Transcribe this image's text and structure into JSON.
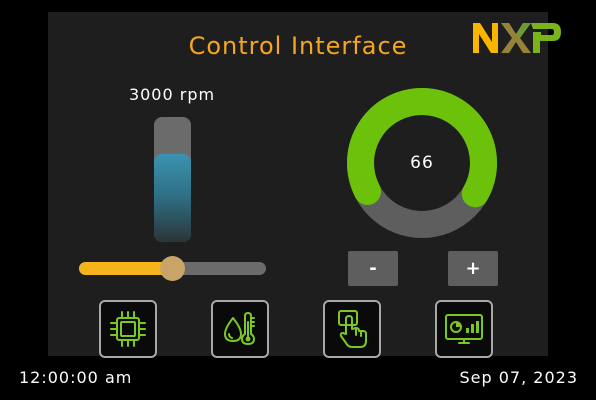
{
  "header": {
    "title": "Control Interface",
    "logo_text": "NXP",
    "logo_colors": [
      "#f9b500",
      "#958437",
      "#7bb31a"
    ]
  },
  "speed": {
    "label": "3000 rpm",
    "bar_level_fraction": 0.7,
    "bar_color": "#3a93b0"
  },
  "slider": {
    "value_fraction": 0.5,
    "accent_color": "#f6b41c"
  },
  "gauge": {
    "value": "66",
    "value_fraction": 0.66,
    "arc_color": "#6cc20a",
    "track_color": "#5e5e5e"
  },
  "stepper": {
    "minus_label": "-",
    "plus_label": "+"
  },
  "nav_buttons": [
    {
      "icon": "processor-chip-icon"
    },
    {
      "icon": "water-temperature-icon"
    },
    {
      "icon": "touch-hand-icon"
    },
    {
      "icon": "dashboard-monitor-icon"
    }
  ],
  "status": {
    "time": "12:00:00 am",
    "date": "Sep 07, 2023"
  },
  "colors": {
    "icon_green": "#7cc823",
    "button_border": "#a8a8a8"
  }
}
